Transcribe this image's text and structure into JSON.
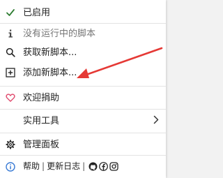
{
  "menu": {
    "enabled": {
      "label": "已启用",
      "icon": "check-icon"
    },
    "no_scripts": {
      "label": "没有运行中的脚本",
      "icon": "info-icon"
    },
    "get_scripts": {
      "label": "获取新脚本...",
      "icon": "search-icon"
    },
    "add_script": {
      "label": "添加新脚本...",
      "icon": "plus-box-icon"
    },
    "donate": {
      "label": "欢迎捐助",
      "icon": "heart-icon"
    },
    "utilities": {
      "label": "实用工具",
      "icon": "chevron-right-icon"
    },
    "dashboard": {
      "label": "管理面板",
      "icon": "gear-icon"
    }
  },
  "footer": {
    "help": "帮助",
    "separator": "|",
    "changelog": "更新日志",
    "icons": [
      "github-icon",
      "facebook-icon",
      "instagram-icon"
    ]
  },
  "colors": {
    "check": "#2e7d32",
    "heart": "#e0486c",
    "info": "#3a7bd5",
    "arrow": "#e53935"
  }
}
